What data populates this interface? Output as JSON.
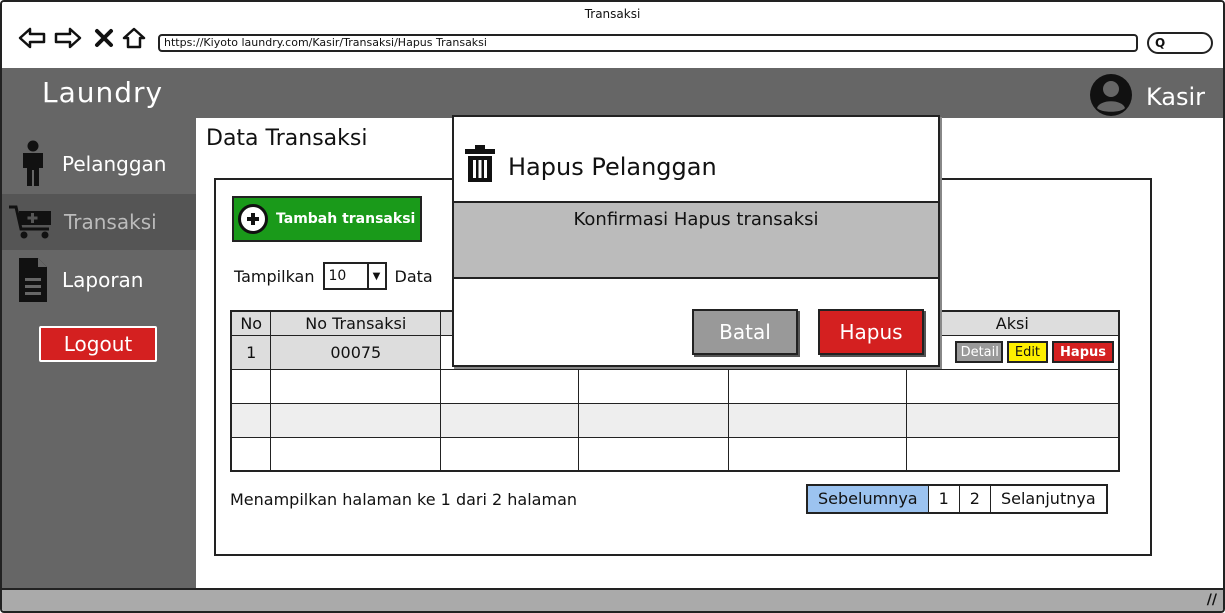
{
  "browser": {
    "window_title": "Transaksi",
    "url": "https://Kiyoto laundry.com/Kasir/Transaksi/Hapus Transaksi",
    "search_glyph": "Q"
  },
  "header": {
    "brand": "Laundry",
    "user_label": "Kasir"
  },
  "sidebar": {
    "items": [
      {
        "label": "Pelanggan",
        "icon": "person-icon"
      },
      {
        "label": "Transaksi",
        "icon": "cart-icon"
      },
      {
        "label": "Laporan",
        "icon": "document-icon"
      }
    ],
    "active": "Transaksi",
    "logout_label": "Logout"
  },
  "main": {
    "page_title": "Data Transaksi",
    "add_button_label": "Tambah transaksi",
    "show_label": "Tampilkan",
    "page_size": "10",
    "data_label": "Data",
    "table": {
      "headers": [
        "No",
        "No Transaksi",
        "",
        "",
        "",
        "Aksi"
      ],
      "rows": [
        [
          "1",
          "00075",
          "",
          "",
          "",
          ""
        ],
        [
          "",
          "",
          "",
          "",
          "",
          ""
        ],
        [
          "",
          "",
          "",
          "",
          "",
          ""
        ],
        [
          "",
          "",
          "",
          "",
          "",
          ""
        ]
      ],
      "actions": {
        "detail": "Detail",
        "edit": "Edit",
        "hapus": "Hapus"
      }
    },
    "footer_info": "Menampilkan halaman ke 1 dari 2 halaman",
    "pagination": {
      "prev": "Sebelumnya",
      "pages": [
        "1",
        "2"
      ],
      "next": "Selanjutnya"
    }
  },
  "modal": {
    "title": "Hapus Pelanggan",
    "message": "Konfirmasi Hapus transaksi",
    "cancel_label": "Batal",
    "confirm_label": "Hapus"
  },
  "colors": {
    "chrome_gray": "#666666",
    "add_green": "#1a9a1a",
    "danger_red": "#d42020",
    "edit_yellow": "#ffef00",
    "pager_prev_blue": "#9cc3f0"
  }
}
